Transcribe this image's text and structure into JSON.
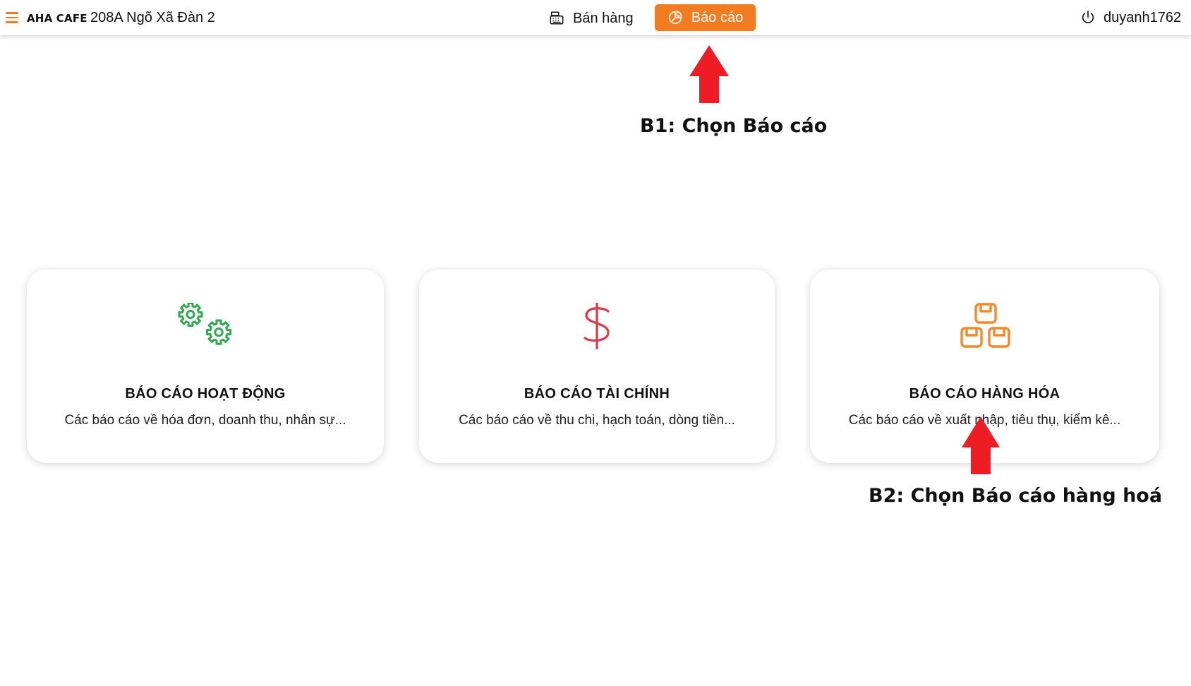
{
  "header": {
    "brand": "AHA CAFE",
    "branch": "208A Ngõ Xã Đàn 2",
    "nav_sales": "Bán hàng",
    "nav_report": "Báo cáo",
    "username": "duyanh1762",
    "accent_color": "#f47c20"
  },
  "cards": [
    {
      "title": "BÁO CÁO HOẠT ĐỘNG",
      "desc": "Các báo cáo về hóa đơn, doanh thu, nhân sự...",
      "icon": "gears-icon",
      "icon_color": "#2fa84f"
    },
    {
      "title": "BÁO CÁO TÀI CHÍNH",
      "desc": "Các báo cáo về thu chi, hạch toán, dòng tiền...",
      "icon": "dollar-icon",
      "icon_color": "#d93a4a"
    },
    {
      "title": "BÁO CÁO HÀNG HÓA",
      "desc": "Các báo cáo về xuất nhập, tiêu thụ, kiểm kê...",
      "icon": "boxes-icon",
      "icon_color": "#f4892a"
    }
  ],
  "annotations": {
    "step1": "B1: Chọn Báo cáo",
    "step2": "B2: Chọn Báo cáo hàng hoá",
    "arrow_color": "#ee1c25"
  }
}
